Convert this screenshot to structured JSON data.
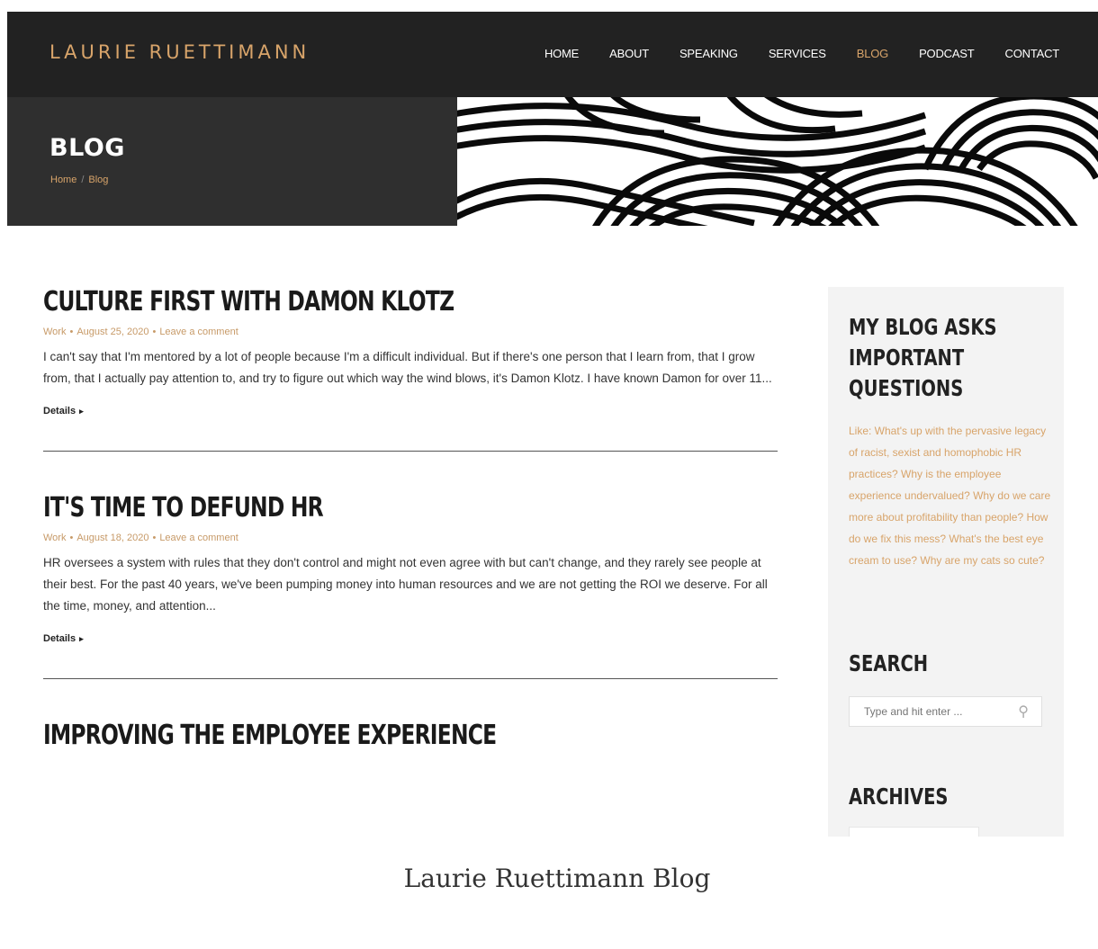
{
  "header": {
    "logo": "LAURIE RUETTIMANN",
    "nav": [
      {
        "label": "HOME",
        "active": false
      },
      {
        "label": "ABOUT",
        "active": false
      },
      {
        "label": "SPEAKING",
        "active": false
      },
      {
        "label": "SERVICES",
        "active": false
      },
      {
        "label": "BLOG",
        "active": true
      },
      {
        "label": "PODCAST",
        "active": false
      },
      {
        "label": "CONTACT",
        "active": false
      }
    ]
  },
  "hero": {
    "title": "BLOG",
    "breadcrumb": [
      "Home",
      "Blog"
    ],
    "breadcrumb_sep": "/"
  },
  "posts": [
    {
      "title": "CULTURE FIRST WITH DAMON KLOTZ",
      "category": "Work",
      "date": "August 25, 2020",
      "comments": "Leave a comment",
      "excerpt": "I can't say that I'm mentored by a lot of people because I'm a difficult individual. But if there's one person that I learn from, that I grow from, that I actually pay attention to, and try to figure out which way the wind blows, it's Damon Klotz. I have known Damon for over 11...",
      "details": "Details"
    },
    {
      "title": "IT'S TIME TO DEFUND HR",
      "category": "Work",
      "date": "August 18, 2020",
      "comments": "Leave a comment",
      "excerpt": "HR oversees a system with rules that they don't control and might not even agree with but can't change, and they rarely see people at their best. For the past 40 years, we've been pumping money into human resources and we are not getting the ROI we deserve. For all the time, money, and attention...",
      "details": "Details"
    },
    {
      "title": "IMPROVING THE EMPLOYEE EXPERIENCE"
    }
  ],
  "sidebar": {
    "about_heading": "MY BLOG ASKS IMPORTANT QUESTIONS",
    "about_text": "Like: What's up with the pervasive legacy of racist, sexist and homophobic HR practices? Why is the employee experience undervalued? Why do we care more about profitability than people? How do we fix this mess? What's the best eye cream to use? Why are my cats so cute?",
    "search_heading": "SEARCH",
    "search_placeholder": "Type and hit enter ...",
    "archives_heading": "ARCHIVES"
  },
  "caption": "Laurie Ruettimann Blog",
  "colors": {
    "accent": "#d8a46a",
    "dark": "#222222"
  }
}
